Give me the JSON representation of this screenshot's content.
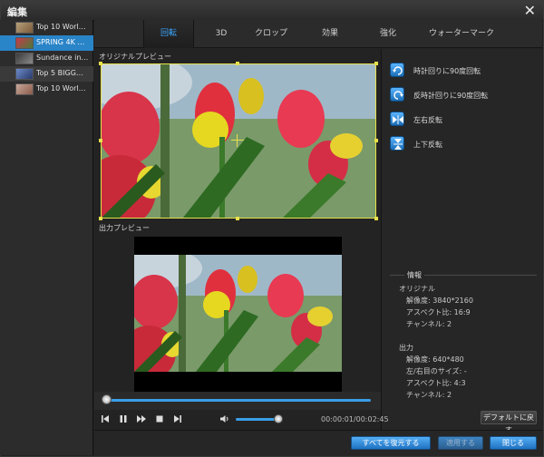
{
  "window": {
    "title": "編集",
    "close": "✕"
  },
  "files": [
    {
      "name": "Top 10 Worl…"
    },
    {
      "name": "SPRING 4K …"
    },
    {
      "name": "Sundance in…"
    },
    {
      "name": "Top 5 BIGG…"
    },
    {
      "name": "Top 10 Worl…"
    }
  ],
  "tabs": [
    "回転",
    "3D",
    "クロップ",
    "効果",
    "強化",
    "ウォーターマーク"
  ],
  "previews": {
    "original_label": "オリジナルプレビュー",
    "output_label": "出力プレビュー"
  },
  "rotate": {
    "cw": "時計回りに90度回転",
    "ccw": "反時計回りに90度回転",
    "flip_h": "左右反転",
    "flip_v": "上下反転"
  },
  "info": {
    "title": "情報",
    "original_header": "オリジナル",
    "orig_resolution": "解像度: 3840*2160",
    "orig_aspect": "アスペクト比: 16:9",
    "orig_channels": "チャンネル: 2",
    "output_header": "出力",
    "out_resolution": "解像度: 640*480",
    "out_border": "左/右目のサイズ: -",
    "out_aspect": "アスペクト比: 4:3",
    "out_channels": "チャンネル: 2"
  },
  "player": {
    "time": "00:00:01/00:02:45",
    "progress": 0.0,
    "volume": 0.8
  },
  "buttons": {
    "default": "デフォルトに戻す",
    "restore_all": "すべてを復元する",
    "apply": "適用する",
    "close": "閉じる"
  },
  "colors": {
    "accent": "#3aa6ff",
    "selection": "#2a84c8",
    "crop_frame": "#e6e04a"
  }
}
